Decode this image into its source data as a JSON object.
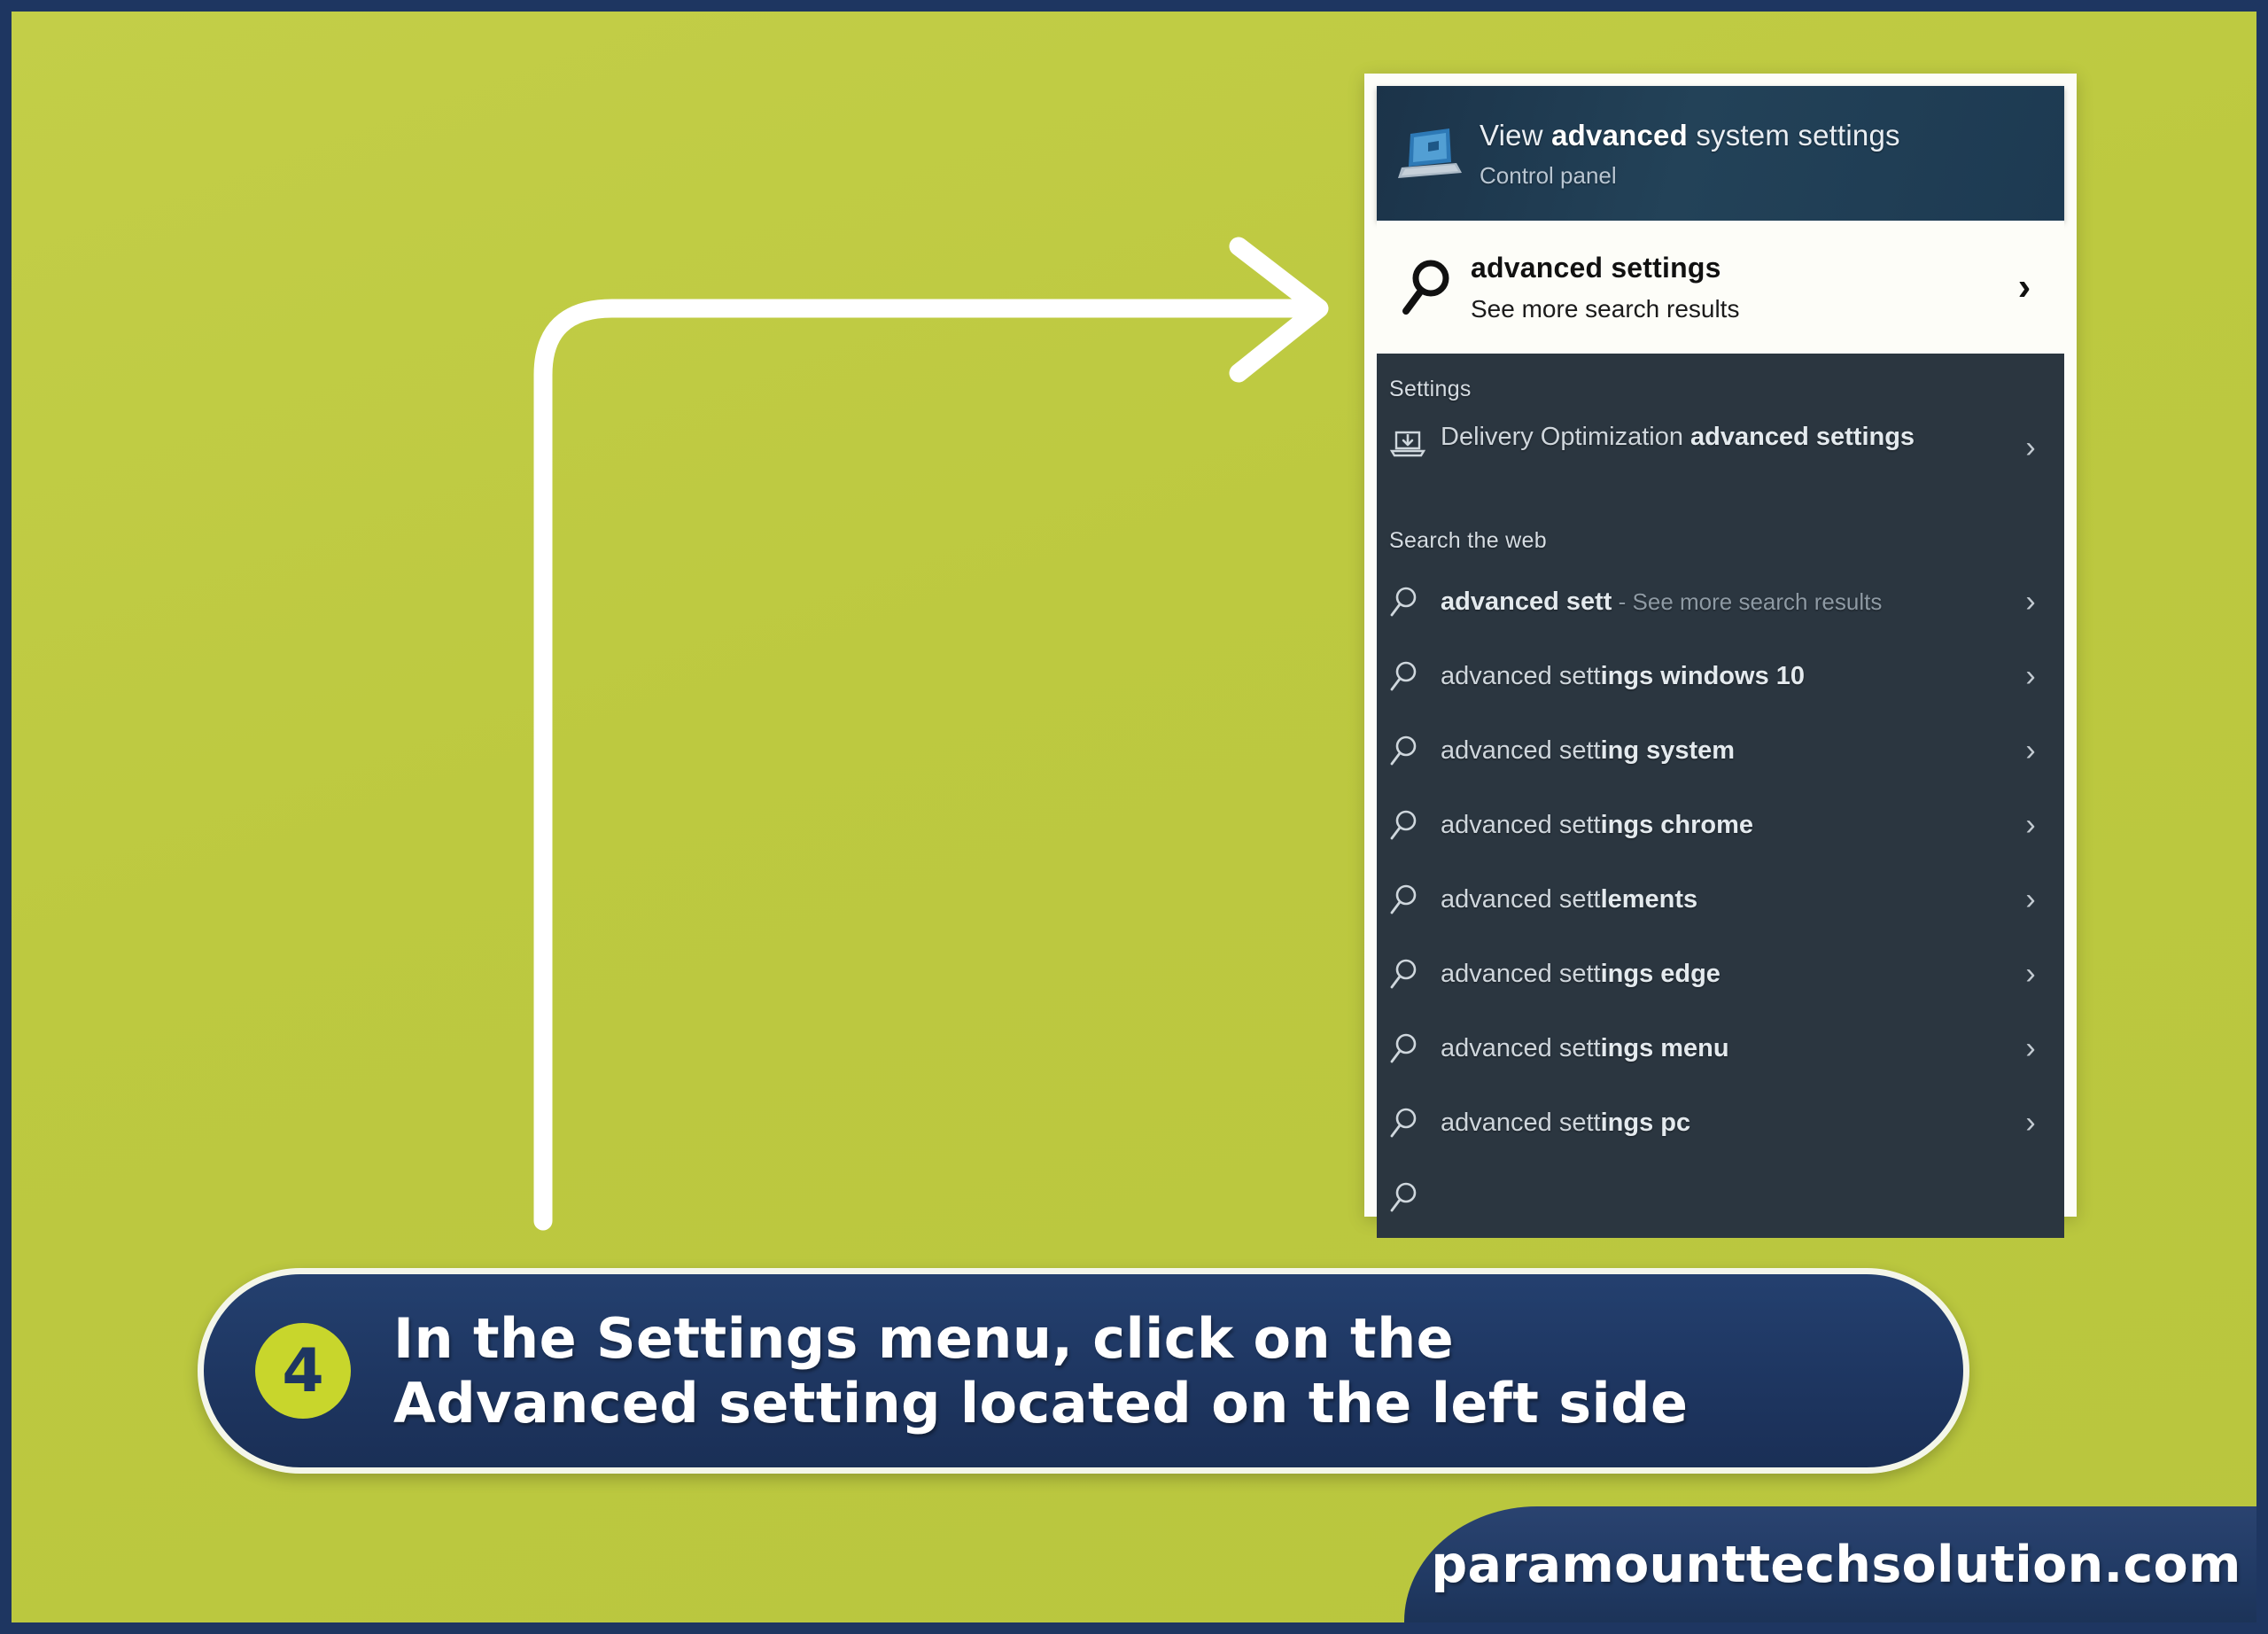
{
  "colors": {
    "background_lime": "#bdc940",
    "frame_navy": "#1e3661",
    "panel_dark": "#2b3640",
    "best_match_blue": "#1d3a52",
    "badge_lime": "#c8d62c",
    "arrow_white": "#ffffff"
  },
  "search_panel": {
    "best_match": {
      "title_prefix": "View ",
      "title_bold": "advanced",
      "title_suffix": " system settings",
      "subtitle": "Control panel",
      "icon": "laptop-control-panel-icon"
    },
    "search_row": {
      "query": "advanced settings",
      "secondary": "See more search results",
      "search_icon": "magnifier-icon",
      "chevron": "chevron-right-icon"
    },
    "groups": [
      {
        "heading": "Settings",
        "items": [
          {
            "icon": "delivery-optimization-icon",
            "text_normal": "Delivery Optimization ",
            "text_bold": "advanced settings",
            "chevron": "chevron-right-icon"
          }
        ]
      },
      {
        "heading": "Search the web",
        "items": [
          {
            "icon": "magnifier-small-icon",
            "text_normal": "advanced sett",
            "text_dim": " - See more search results",
            "chevron": "chevron-right-icon"
          },
          {
            "icon": "magnifier-small-icon",
            "text_normal": "advanced sett",
            "text_bold": "ings windows 10",
            "chevron": "chevron-right-icon"
          },
          {
            "icon": "magnifier-small-icon",
            "text_normal": "advanced sett",
            "text_bold": "ing system",
            "chevron": "chevron-right-icon"
          },
          {
            "icon": "magnifier-small-icon",
            "text_normal": "advanced sett",
            "text_bold": "ings chrome",
            "chevron": "chevron-right-icon"
          },
          {
            "icon": "magnifier-small-icon",
            "text_normal": "advanced sett",
            "text_bold": "lements",
            "chevron": "chevron-right-icon"
          },
          {
            "icon": "magnifier-small-icon",
            "text_normal": "advanced sett",
            "text_bold": "ings edge",
            "chevron": "chevron-right-icon"
          },
          {
            "icon": "magnifier-small-icon",
            "text_normal": "advanced sett",
            "text_bold": "ings menu",
            "chevron": "chevron-right-icon"
          },
          {
            "icon": "magnifier-small-icon",
            "text_normal": "advanced sett",
            "text_bold": "ings pc",
            "chevron": "chevron-right-icon"
          }
        ]
      }
    ]
  },
  "annotation": {
    "arrow": "curved-arrow-pointing-right",
    "step_number": "4",
    "caption_line1": "In the Settings menu, click on the",
    "caption_line2": "Advanced setting located on the left side"
  },
  "footer": {
    "website": "paramounttechsolution.com"
  }
}
